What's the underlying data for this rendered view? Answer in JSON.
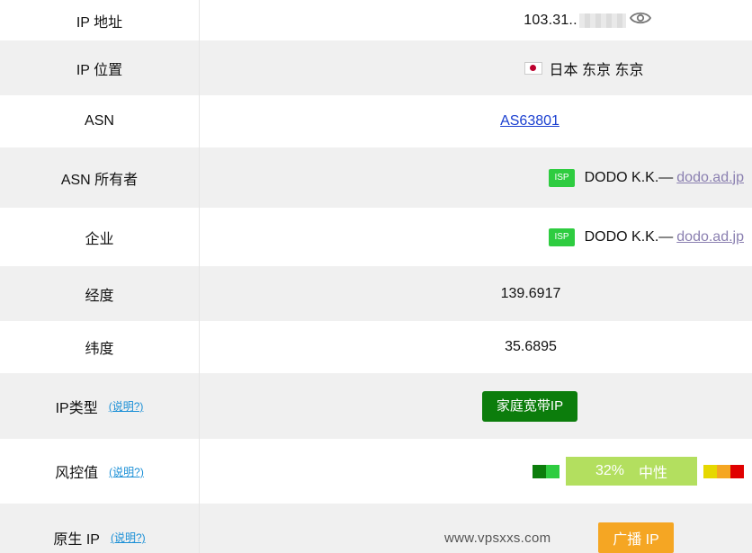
{
  "rows": {
    "ip_address": {
      "label": "IP 地址",
      "value": "103.31.."
    },
    "ip_location": {
      "label": "IP 位置",
      "value": "日本 东京 东京"
    },
    "asn": {
      "label": "ASN",
      "value": "AS63801"
    },
    "asn_owner": {
      "label": "ASN 所有者",
      "badge": "ISP",
      "name": "DODO K.K.—",
      "domain": "dodo.ad.jp"
    },
    "company": {
      "label": "企业",
      "badge": "ISP",
      "name": "DODO K.K.—",
      "domain": "dodo.ad.jp"
    },
    "longitude": {
      "label": "经度",
      "value": "139.6917"
    },
    "latitude": {
      "label": "纬度",
      "value": "35.6895"
    },
    "ip_type": {
      "label": "IP类型",
      "help": "(说明?)",
      "value": "家庭宽带IP"
    },
    "risk": {
      "label": "风控值",
      "help": "(说明?)",
      "percent": "32%",
      "level": "中性",
      "score_fraction": 0.32
    },
    "native_ip": {
      "label": "原生 IP",
      "help": "(说明?)",
      "value": "广播 IP"
    }
  },
  "watermark": "www.vpsxxs.com",
  "colors": {
    "row_alt": "#f0f0f0",
    "link": "#1a3fd0",
    "help_link": "#1a8fd6",
    "isp_badge": "#2ecc40",
    "ip_type_button": "#0c7d0c",
    "risk_main": "#b3df5f",
    "native_button": "#f5a623",
    "risk_low_left": [
      "#0c7d0c",
      "#2ecc40"
    ],
    "risk_high_right": [
      "#e6d800",
      "#f5a623",
      "#e00000"
    ]
  },
  "icons": {
    "ip_visibility": "eye-icon",
    "location_flag": "japan-flag-icon"
  }
}
